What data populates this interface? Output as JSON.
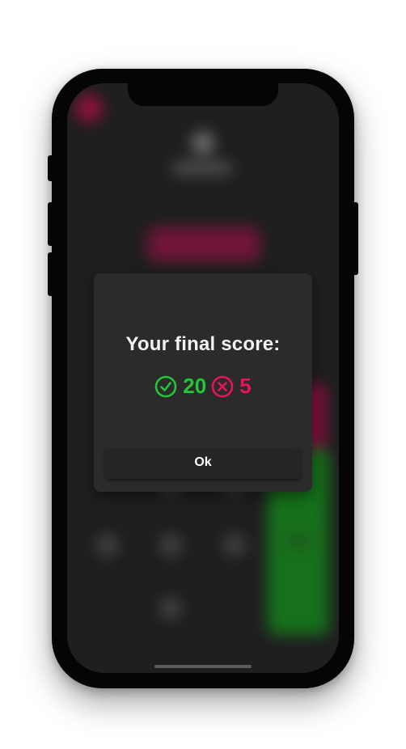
{
  "dialog": {
    "title": "Your final score:",
    "correct_count": "20",
    "wrong_count": "5",
    "ok_label": "Ok"
  },
  "icons": {
    "correct": "check-circle-icon",
    "wrong": "x-circle-icon"
  },
  "colors": {
    "correct": "#22c63a",
    "wrong": "#e8145a",
    "dialog_background": "#2b2b2b",
    "screen_background": "#262626"
  }
}
